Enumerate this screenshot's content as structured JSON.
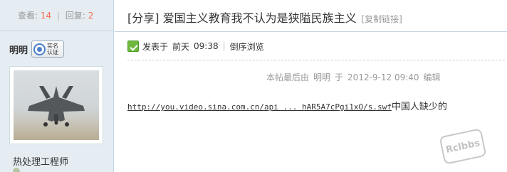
{
  "stats": {
    "views_label": "查看:",
    "views": "14",
    "separator": "|",
    "replies_label": "回复:",
    "replies": "2"
  },
  "author": {
    "name": "明明",
    "badge_text": "实名认证",
    "user_title": "热处理工程师"
  },
  "post": {
    "title": "[分享] 爱国主义教育我不认为是狭隘民族主义",
    "copy_link": "[复制链接]",
    "posted_prefix": "发表于",
    "posted_day": "前天",
    "posted_time": "09:38",
    "separator": "|",
    "reverse_view": "倒序浏览",
    "edit_status": {
      "label": "本帖最后由",
      "editor": "明明",
      "at": "于",
      "datetime": "2012-9-12 09:40",
      "action": "编辑"
    },
    "link_text": "http://you.video.sina.com.cn/api ... hAR5A7cPgi1xO/s.swf",
    "body_tail": "中国人缺少的"
  },
  "watermark": "Rclbbs",
  "colors": {
    "sidebar_bg": "#e5edf2",
    "border": "#c2d5e3",
    "stat_number": "#f26c4f"
  }
}
